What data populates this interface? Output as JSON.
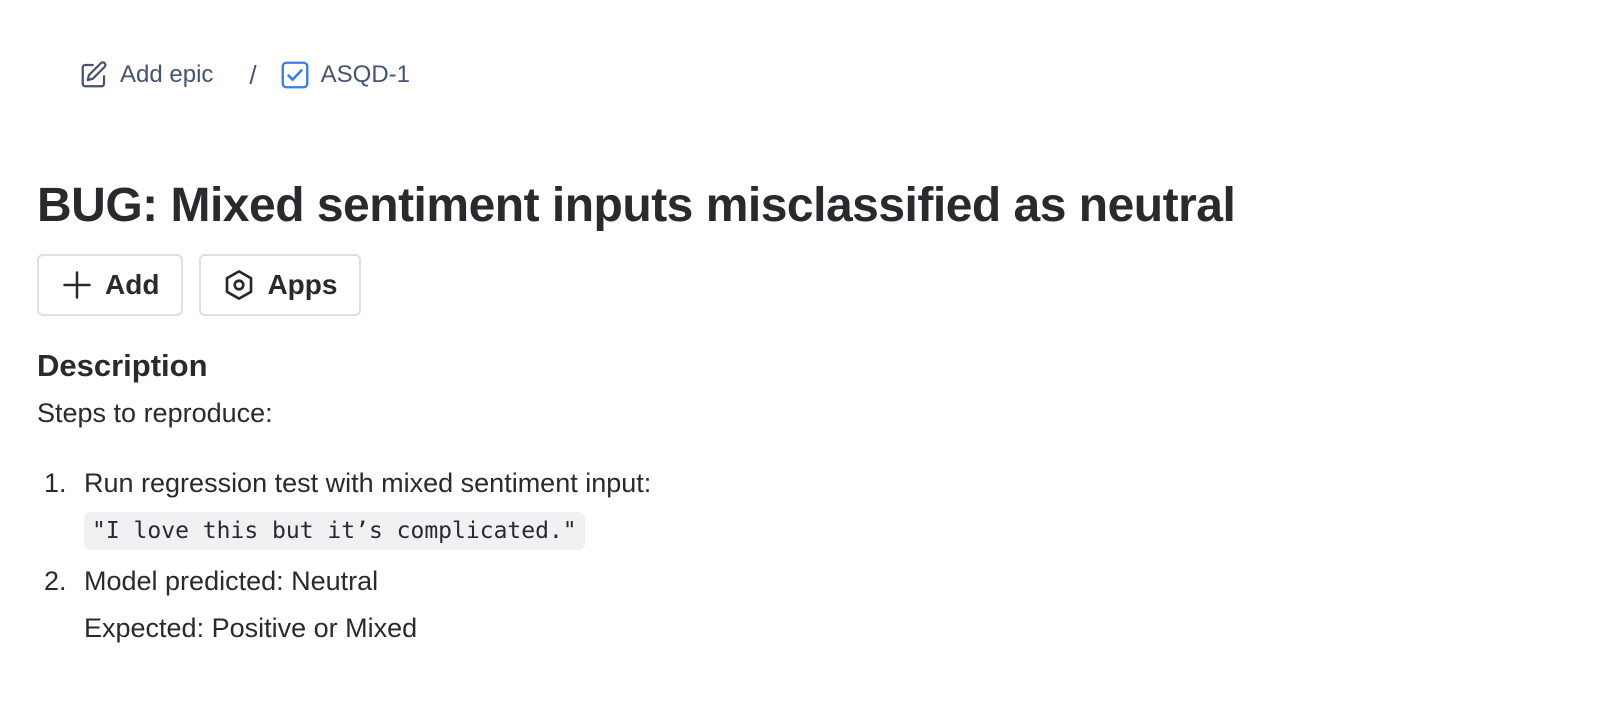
{
  "breadcrumb": {
    "epic": {
      "label": "Add epic",
      "icon": "edit-icon"
    },
    "separator": "/",
    "issue": {
      "key": "ASQD-1",
      "icon": "task-checkbox-icon",
      "icon_color": "#357de8"
    }
  },
  "title": "BUG: Mixed sentiment inputs misclassified as neutral",
  "actions": {
    "add_label": "Add",
    "apps_label": "Apps"
  },
  "description": {
    "heading": "Description",
    "intro": "Steps to reproduce:",
    "steps": [
      {
        "number": "1.",
        "text": "Run regression test with mixed sentiment input:",
        "code": "\"I love this but it’s complicated.\""
      },
      {
        "number": "2.",
        "text": "Model predicted: Neutral",
        "subtext": "Expected: Positive or Mixed"
      }
    ]
  },
  "colors": {
    "text": "#292a2e",
    "subtle_text": "#44546f",
    "border": "#dcdfe4",
    "code_bg": "#f0f1f2",
    "accent": "#357de8"
  }
}
